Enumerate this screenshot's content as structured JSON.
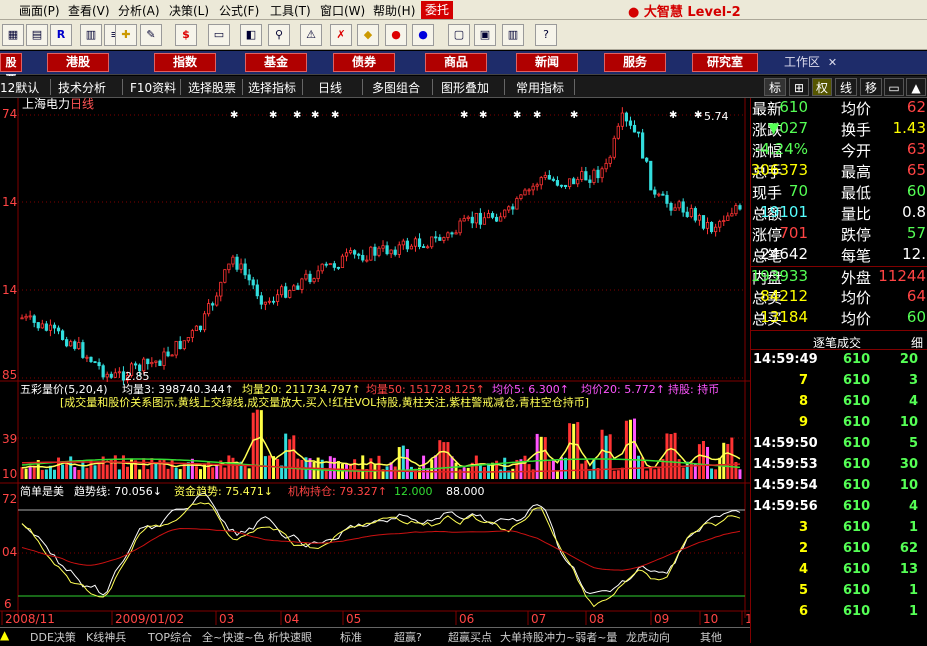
{
  "menu": {
    "items": [
      "画面(P)",
      "查看(V)",
      "分析(A)",
      "决策(L)",
      "公式(F)",
      "工具(T)",
      "窗口(W)",
      "帮助(H)"
    ],
    "weituo": "委托",
    "brand": "大智慧 Level-2"
  },
  "nav": {
    "left_label": "股票",
    "buttons": [
      "港股",
      "指数",
      "基金",
      "债券",
      "商品",
      "新闻",
      "服务",
      "研究室"
    ],
    "workarea": "工作区"
  },
  "tabs": {
    "items": [
      "12默认",
      "技术分析",
      "F10资料",
      "选择股票",
      "选择指标",
      "日线",
      "多图组合",
      "图形叠加",
      "常用指标"
    ],
    "right": [
      "标",
      "权",
      "线",
      "移"
    ]
  },
  "chart": {
    "stock_title": "上海电力",
    "period": "日线",
    "price_labels": [
      "74",
      "14",
      "14",
      "85"
    ],
    "high_label": "5.74",
    "low_label": "2.85",
    "vol_header": {
      "name": "五彩量价(5,20,4)",
      "items": [
        "均量3: 398740.344↑",
        "均量20: 211734.797↑",
        "均量50: 151728.125↑",
        "均价5: 6.300↑",
        "均价20: 5.772↑",
        "持股: 持币"
      ]
    },
    "vol_hint": "[成交量和股价关系图示,黄线上交绿线,成交量放大,买入!红柱VOL持股,黄柱关注,紫柱警戒减仓,青柱空仓持币]",
    "vol_labels": [
      "39",
      "10"
    ],
    "ind_header": {
      "name": "简单是美",
      "items": [
        "趋势线: 70.056↓",
        "资金趋势: 75.471↓",
        "机构持仓: 79.327↑",
        "12.000",
        "88.000"
      ]
    },
    "ind_labels": [
      "72",
      "04",
      "6"
    ],
    "dates": [
      "2008/11",
      "2009/01/02",
      "03",
      "04",
      "05",
      "06",
      "07",
      "08",
      "09",
      "10",
      "11"
    ]
  },
  "quote": {
    "rows": [
      {
        "l": "最新",
        "v": "610",
        "l2": "均价",
        "v2": "62",
        "c": "#55ff55",
        "c2": "#ff4444"
      },
      {
        "l": "涨跌",
        "v": "▼027",
        "l2": "换手",
        "v2": "1.43",
        "c": "#55ff55",
        "c2": "#ffff00"
      },
      {
        "l": "涨幅",
        "v": "-4.24%",
        "l2": "今开",
        "v2": "63",
        "c": "#55ff55",
        "c2": "#ff4444"
      },
      {
        "l": "总手",
        "v": "306373",
        "l2": "最高",
        "v2": "65",
        "c": "#ffff00",
        "c2": "#ff4444"
      },
      {
        "l": "现手",
        "v": "70",
        "l2": "最低",
        "v2": "60",
        "c": "#55ff55",
        "c2": "#55ff55"
      },
      {
        "l": "总额",
        "v": "19101",
        "l2": "量比",
        "v2": "0.8",
        "c": "#55ffff",
        "c2": "#ffffff"
      },
      {
        "l": "涨停",
        "v": "701",
        "l2": "跌停",
        "v2": "57",
        "c": "#ff4444",
        "c2": "#55ff55"
      },
      {
        "l": "总笔",
        "v": "24642",
        "l2": "每笔",
        "v2": "12.",
        "c": "#ffffff",
        "c2": "#ffffff"
      },
      {
        "l": "内盘",
        "v": "193933",
        "l2": "外盘",
        "v2": "11244",
        "c": "#55ff55",
        "c2": "#ff4444"
      },
      {
        "l": "总卖",
        "v": "84212",
        "l2": "均价",
        "v2": "64",
        "c": "#ffff00",
        "c2": "#ff4444"
      },
      {
        "l": "总买",
        "v": "13184",
        "l2": "均价",
        "v2": "60",
        "c": "#ffff00",
        "c2": "#55ff55"
      }
    ],
    "tick_title": "逐笔成交",
    "tick_extra": "细",
    "ticks": [
      {
        "t": "14:59:49",
        "p": "610",
        "v": "20",
        "c": "#55ff55"
      },
      {
        "t": "7",
        "p": "610",
        "v": "3",
        "c": "#55ff55"
      },
      {
        "t": "8",
        "p": "610",
        "v": "4",
        "c": "#55ff55"
      },
      {
        "t": "9",
        "p": "610",
        "v": "10",
        "c": "#55ff55"
      },
      {
        "t": "14:59:50",
        "p": "610",
        "v": "5",
        "c": "#55ff55"
      },
      {
        "t": "14:59:53",
        "p": "610",
        "v": "30",
        "c": "#55ff55"
      },
      {
        "t": "14:59:54",
        "p": "610",
        "v": "10",
        "c": "#55ff55"
      },
      {
        "t": "14:59:56",
        "p": "610",
        "v": "4",
        "c": "#55ff55"
      },
      {
        "t": "3",
        "p": "610",
        "v": "1",
        "c": "#55ff55"
      },
      {
        "t": "2",
        "p": "610",
        "v": "62",
        "c": "#55ff55"
      },
      {
        "t": "4",
        "p": "610",
        "v": "13",
        "c": "#55ff55"
      },
      {
        "t": "5",
        "p": "610",
        "v": "1",
        "c": "#55ff55"
      },
      {
        "t": "6",
        "p": "610",
        "v": "1",
        "c": "#55ff55"
      }
    ]
  },
  "bottom": {
    "items": [
      "DDE决策",
      "K线神兵",
      "TOP综合",
      "全~快速~色",
      "析快速眼",
      "标准",
      "超赢?",
      "超赢买点",
      "大单持股冲力~弱者~量",
      "龙虎动向",
      "其他"
    ]
  }
}
